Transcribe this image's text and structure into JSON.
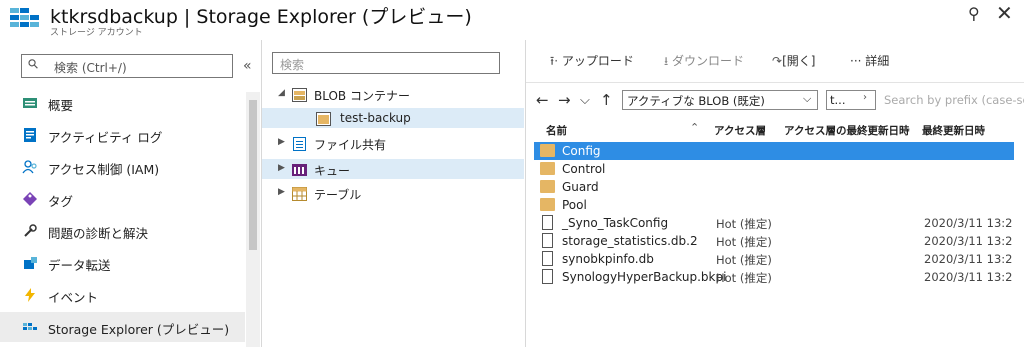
{
  "header": {
    "title": "ktkrsdbackup | Storage Explorer (プレビュー)",
    "subtitle": "ストレージ アカウント"
  },
  "left_nav": {
    "search_placeholder": "検索 (Ctrl+/)",
    "items": [
      {
        "label": "概要",
        "icon": "overview-icon"
      },
      {
        "label": "アクティビティ ログ",
        "icon": "activity-log-icon"
      },
      {
        "label": "アクセス制御 (IAM)",
        "icon": "iam-icon"
      },
      {
        "label": "タグ",
        "icon": "tag-icon"
      },
      {
        "label": "問題の診断と解決",
        "icon": "wrench-icon"
      },
      {
        "label": "データ転送",
        "icon": "data-transfer-icon"
      },
      {
        "label": "イベント",
        "icon": "lightning-icon"
      },
      {
        "label": "Storage Explorer (プレビュー)",
        "icon": "storage-explorer-icon"
      }
    ]
  },
  "tree": {
    "search_placeholder": "検索",
    "items": [
      {
        "label": "BLOB コンテナー"
      },
      {
        "label": "test-backup"
      },
      {
        "label": "ファイル共有"
      },
      {
        "label": "キュー"
      },
      {
        "label": "テーブル"
      }
    ]
  },
  "toolbar": {
    "upload": "アップロード",
    "download": "ダウンロード",
    "open": "[開く]",
    "details": "詳細"
  },
  "navbar": {
    "tier_select": "アクティブな BLOB (既定)",
    "short_select": "t...",
    "prefix_placeholder": "Search by prefix (case-sen"
  },
  "columns": {
    "name": "名前",
    "tier": "アクセス層",
    "tier_modified": "アクセス層の最終更新日時",
    "last_modified": "最終更新日時"
  },
  "rows": [
    {
      "name": "Config",
      "type": "folder",
      "tier": "",
      "modified": ""
    },
    {
      "name": "Control",
      "type": "folder",
      "tier": "",
      "modified": ""
    },
    {
      "name": "Guard",
      "type": "folder",
      "tier": "",
      "modified": ""
    },
    {
      "name": "Pool",
      "type": "folder",
      "tier": "",
      "modified": ""
    },
    {
      "name": "_Syno_TaskConfig",
      "type": "file",
      "tier": "Hot (推定)",
      "modified": "2020/3/11 13:2"
    },
    {
      "name": "storage_statistics.db.2",
      "type": "file",
      "tier": "Hot (推定)",
      "modified": "2020/3/11 13:2"
    },
    {
      "name": "synobkpinfo.db",
      "type": "file",
      "tier": "Hot (推定)",
      "modified": "2020/3/11 13:2"
    },
    {
      "name": "SynologyHyperBackup.bkpi",
      "type": "file",
      "tier": "Hot (推定)",
      "modified": "2020/3/11 13:2"
    }
  ],
  "colors": {
    "selection": "#2e8de4",
    "tree_selection": "#dcebf7",
    "folder": "#e5b664"
  }
}
